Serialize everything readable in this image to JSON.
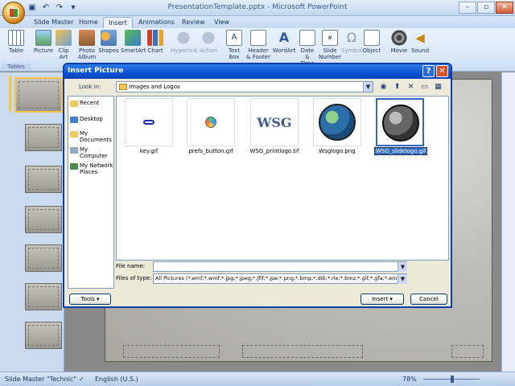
{
  "app": {
    "title": "PresentationTemplate.pptx - Microsoft PowerPoint",
    "tabs": [
      "Slide Master",
      "Home",
      "Insert",
      "Animations",
      "Review",
      "View"
    ],
    "active_tab": "Insert"
  },
  "ribbon": {
    "buttons": [
      {
        "label": "Table",
        "icon": "table-icon"
      },
      {
        "label": "Picture",
        "icon": "picture-icon"
      },
      {
        "label": "Clip Art",
        "icon": "clip-art-icon"
      },
      {
        "label": "Photo Album",
        "icon": "photo-album-icon"
      },
      {
        "label": "Shapes",
        "icon": "shapes-icon"
      },
      {
        "label": "SmartArt",
        "icon": "smartart-icon"
      },
      {
        "label": "Chart",
        "icon": "chart-icon"
      },
      {
        "label": "Hyperlink",
        "icon": "hyperlink-icon"
      },
      {
        "label": "Action",
        "icon": "action-icon"
      },
      {
        "label": "Text Box",
        "icon": "text-box-icon"
      },
      {
        "label": "Header & Footer",
        "icon": "header-footer-icon"
      },
      {
        "label": "WordArt",
        "icon": "wordart-icon"
      },
      {
        "label": "Date & Time",
        "icon": "date-time-icon"
      },
      {
        "label": "Slide Number",
        "icon": "slide-number-icon"
      },
      {
        "label": "Symbol",
        "icon": "symbol-icon"
      },
      {
        "label": "Object",
        "icon": "object-icon"
      },
      {
        "label": "Movie",
        "icon": "movie-icon"
      },
      {
        "label": "Sound",
        "icon": "sound-icon"
      }
    ],
    "group_tables": "Tables"
  },
  "dialog": {
    "title": "Insert Picture",
    "look_in_label": "Look in:",
    "look_in_value": "Images and Logos",
    "places": [
      "Recent",
      "Desktop",
      "My Documents",
      "My Computer",
      "My Network Places"
    ],
    "files": [
      {
        "name": "key.gif"
      },
      {
        "name": "prefs_button.gif"
      },
      {
        "name": "WSG_printlogo.tif",
        "text": "WSG"
      },
      {
        "name": "Wsglogo.png"
      },
      {
        "name": "WSG_slidelogo.gif",
        "selected": true
      }
    ],
    "file_name_label": "File name:",
    "file_name_value": "",
    "files_of_type_label": "Files of type:",
    "files_of_type_value": "All Pictures (*.emf;*.wmf;*.jpg;*.jpeg;*.jfif;*.jpe;*.png;*.bmp;*.dib;*.rle;*.bmz;*.gif;*.gfa;*.emz",
    "tools_label": "Tools",
    "insert_label": "Insert",
    "cancel_label": "Cancel"
  },
  "status": {
    "view": "Slide Master",
    "theme": "\"Technic\"",
    "language": "English (U.S.)",
    "zoom": "78%"
  },
  "colors": {
    "dialog_title": "#0a53d6",
    "selection": "#316ac5"
  }
}
